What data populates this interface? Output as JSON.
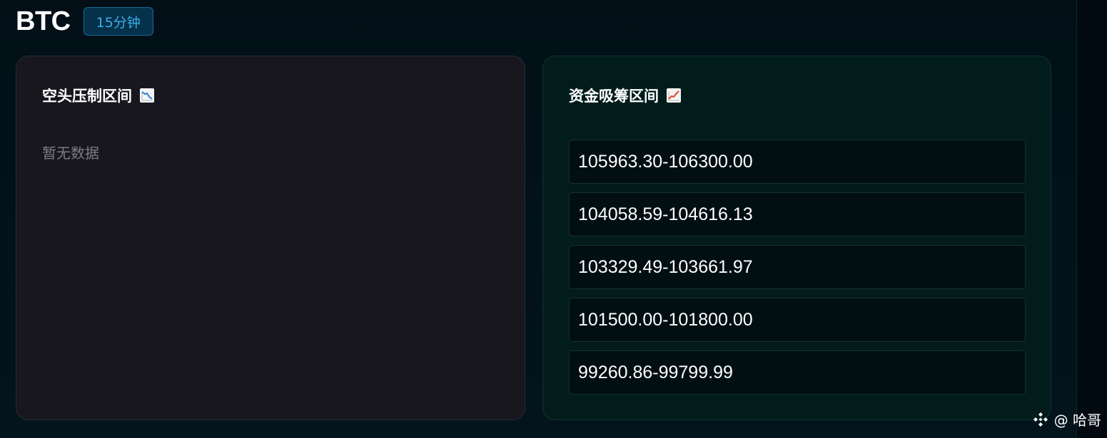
{
  "header": {
    "symbol": "BTC",
    "timeframe": "15分钟"
  },
  "short_zone": {
    "title": "空头压制区间",
    "icon": "chart-decreasing-icon",
    "empty_text": "暂无数据"
  },
  "long_zone": {
    "title": "资金吸筹区间",
    "icon": "chart-increasing-icon",
    "ranges": [
      "105963.30-106300.00",
      "104058.59-104616.13",
      "103329.49-103661.97",
      "101500.00-101800.00",
      "99260.86-99799.99"
    ]
  },
  "watermark": {
    "icon": "binance-logo-icon",
    "text": "@ 哈哥"
  },
  "colors": {
    "background": "#02111a",
    "short_card_bg": "#18171e",
    "long_card_bg": "#021c1c",
    "timeframe_accent": "#3aaee8"
  }
}
